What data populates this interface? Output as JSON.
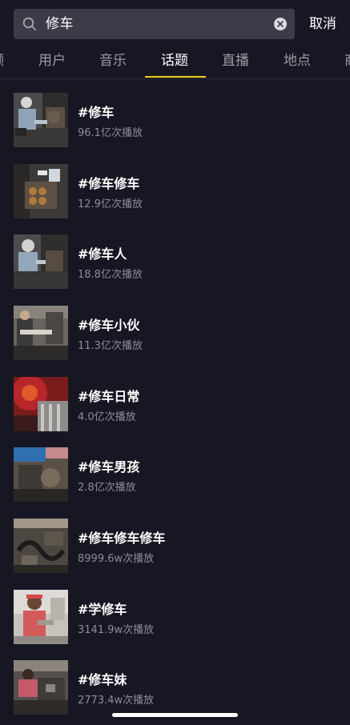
{
  "search": {
    "query": "修车",
    "cancel_label": "取消"
  },
  "tabs": [
    {
      "label": "频",
      "active": false
    },
    {
      "label": "用户",
      "active": false
    },
    {
      "label": "音乐",
      "active": false
    },
    {
      "label": "话题",
      "active": true
    },
    {
      "label": "直播",
      "active": false
    },
    {
      "label": "地点",
      "active": false
    },
    {
      "label": "商",
      "active": false
    }
  ],
  "topics": [
    {
      "name": "#修车",
      "plays": "96.1亿次播放"
    },
    {
      "name": "#修车修车",
      "plays": "12.9亿次播放"
    },
    {
      "name": "#修车人",
      "plays": "18.8亿次播放"
    },
    {
      "name": "#修车小伙",
      "plays": "11.3亿次播放"
    },
    {
      "name": "#修车日常",
      "plays": "4.0亿次播放"
    },
    {
      "name": "#修车男孩",
      "plays": "2.8亿次播放"
    },
    {
      "name": "#修车修车修车",
      "plays": "8999.6w次播放"
    },
    {
      "name": "#学修车",
      "plays": "3141.9w次播放"
    },
    {
      "name": "#修车妹",
      "plays": "2773.4w次播放"
    }
  ],
  "colors": {
    "background": "#161723",
    "accent_underline": "#face15",
    "search_field": "#3b3c48",
    "secondary_text": "#8c8d96"
  }
}
